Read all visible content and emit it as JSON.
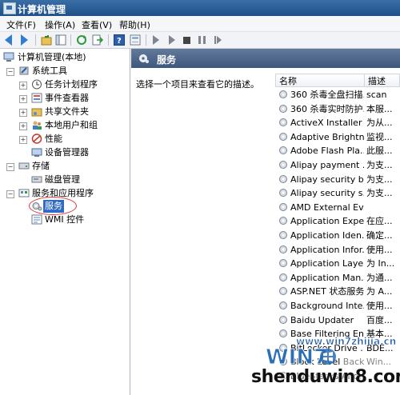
{
  "window": {
    "title": "计算机管理"
  },
  "menu": [
    "文件(F)",
    "操作(A)",
    "查看(V)",
    "帮助(H)"
  ],
  "tree": {
    "root": "计算机管理(本地)",
    "system_tools": "系统工具",
    "task_scheduler": "任务计划程序",
    "event_viewer": "事件查看器",
    "shared_folders": "共享文件夹",
    "local_users": "本地用户和组",
    "performance": "性能",
    "device_manager": "设备管理器",
    "storage": "存储",
    "disk_management": "磁盘管理",
    "services_apps": "服务和应用程序",
    "services": "服务",
    "wmi": "WMI 控件"
  },
  "right": {
    "header": "服务",
    "description_hint": "选择一个项目来查看它的描述。",
    "columns": {
      "name": "名称",
      "description": "描述"
    }
  },
  "services": [
    {
      "name": "360 杀毒全盘扫描...",
      "desc": "scan"
    },
    {
      "name": "360 杀毒实时防护...",
      "desc": "本服..."
    },
    {
      "name": "ActiveX Installer ...",
      "desc": "为从..."
    },
    {
      "name": "Adaptive Brightn...",
      "desc": "监视..."
    },
    {
      "name": "Adobe Flash Pla...",
      "desc": "此服..."
    },
    {
      "name": "Alipay payment ...",
      "desc": "为支..."
    },
    {
      "name": "Alipay security b...",
      "desc": "为支..."
    },
    {
      "name": "Alipay security s...",
      "desc": "为支..."
    },
    {
      "name": "AMD External Ev...",
      "desc": ""
    },
    {
      "name": "Application Expe...",
      "desc": "在应..."
    },
    {
      "name": "Application Iden...",
      "desc": "确定..."
    },
    {
      "name": "Application Infor...",
      "desc": "使用..."
    },
    {
      "name": "Application Laye...",
      "desc": "为 In..."
    },
    {
      "name": "Application Man...",
      "desc": "为通..."
    },
    {
      "name": "ASP.NET 状态服务",
      "desc": "为 A..."
    },
    {
      "name": "Background Inte...",
      "desc": "使用..."
    },
    {
      "name": "Baidu Updater",
      "desc": "百度..."
    },
    {
      "name": "Base Filtering En...",
      "desc": "基本..."
    },
    {
      "name": "BitLocker Drive ...",
      "desc": "BDE..."
    },
    {
      "name": "Block Level Back...",
      "desc": "Win..."
    },
    {
      "name": "BlueStacks Andr...",
      "desc": ""
    }
  ],
  "watermark": {
    "top": "www.win7zhijia.cn",
    "bottom": "shenduwin8.com",
    "logo_text": "WIN7"
  },
  "colors": {
    "accent": "#316ac5",
    "titlebar": "#1f4f8a",
    "header_band": "#4a6488",
    "highlight_circle": "#e03a3a"
  }
}
